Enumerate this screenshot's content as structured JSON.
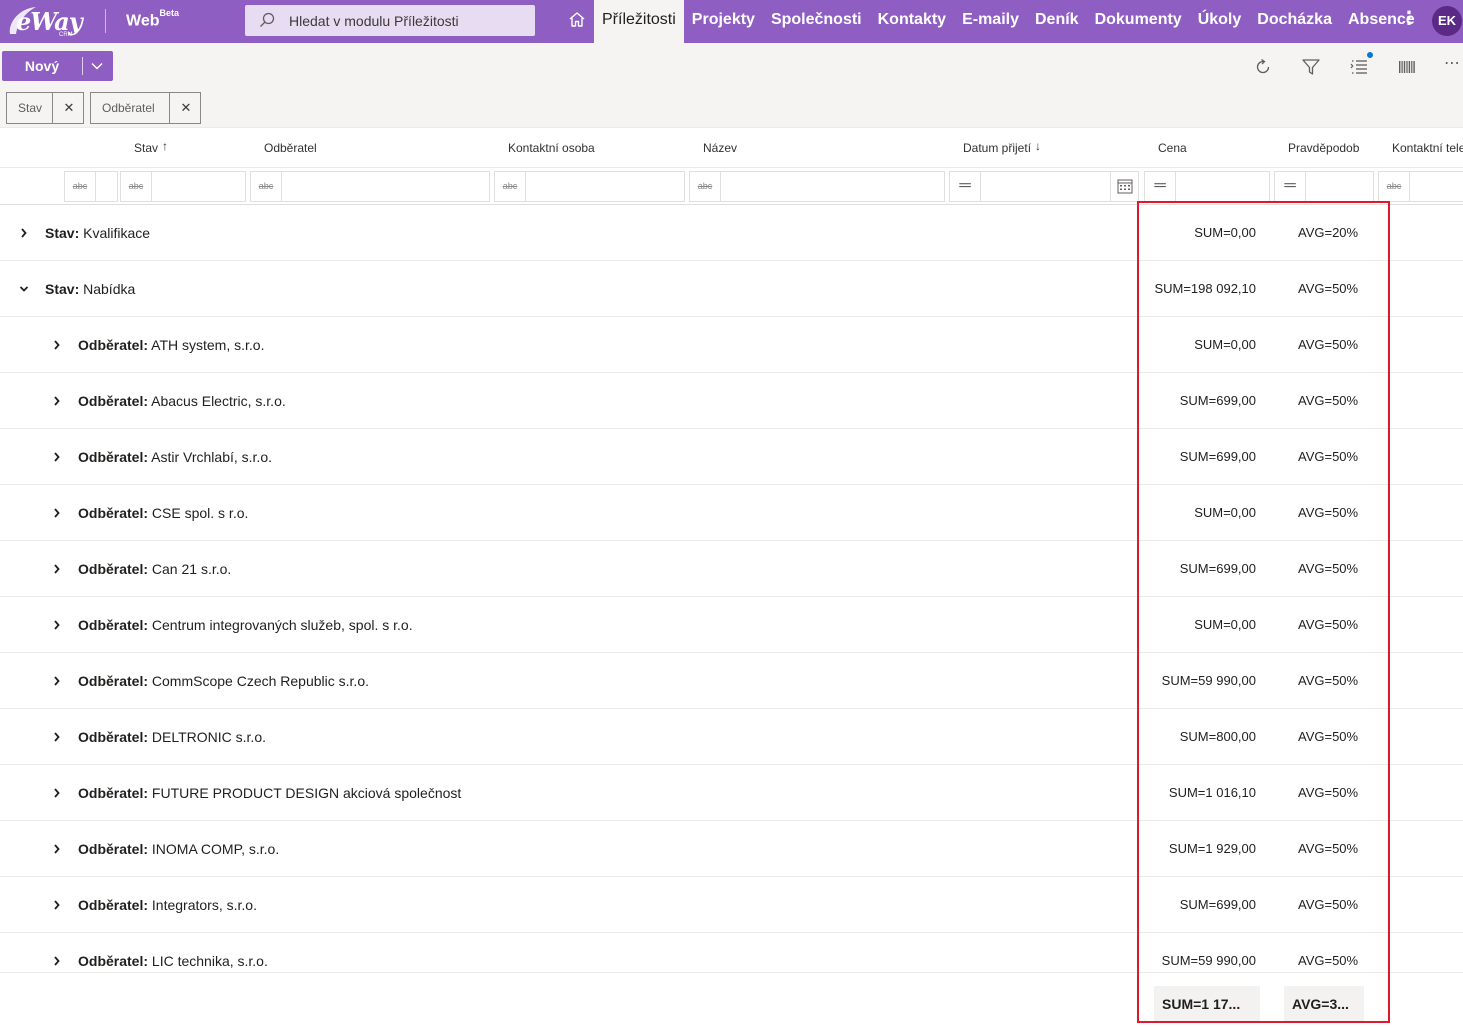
{
  "app": {
    "logo": "eWay",
    "logo_sub": "CRM",
    "web_title": "Web",
    "web_badge": "Beta",
    "search_placeholder": "Hledat v modulu Příležitosti",
    "user_initials": "EK",
    "accent_color": "#8f5ec2"
  },
  "nav": [
    {
      "label": "Příležitosti",
      "active": true
    },
    {
      "label": "Projekty"
    },
    {
      "label": "Společnosti"
    },
    {
      "label": "Kontakty"
    },
    {
      "label": "E-maily"
    },
    {
      "label": "Deník"
    },
    {
      "label": "Dokumenty"
    },
    {
      "label": "Úkoly"
    },
    {
      "label": "Docházka"
    },
    {
      "label": "Absence"
    }
  ],
  "toolbar": {
    "new_label": "Nový",
    "icons": [
      "refresh-icon",
      "filter-icon",
      "column-list-icon",
      "barcode-icon",
      "more-icon"
    ]
  },
  "group_chips": [
    {
      "label": "Stav"
    },
    {
      "label": "Odběratel"
    }
  ],
  "columns": [
    {
      "label": "Stav",
      "sort": "asc"
    },
    {
      "label": "Odběratel"
    },
    {
      "label": "Kontaktní osoba"
    },
    {
      "label": "Název"
    },
    {
      "label": "Datum přijetí",
      "sort": "desc"
    },
    {
      "label": "Cena"
    },
    {
      "label": "Pravděpodob"
    },
    {
      "label": "Kontaktní tele"
    }
  ],
  "rows": [
    {
      "level": 0,
      "expanded": false,
      "key": "Stav:",
      "value": "Kvalifikace",
      "sum": "SUM=0,00",
      "avg": "AVG=20%"
    },
    {
      "level": 0,
      "expanded": true,
      "key": "Stav:",
      "value": "Nabídka",
      "sum": "SUM=198 092,10",
      "avg": "AVG=50%"
    },
    {
      "level": 1,
      "expanded": false,
      "key": "Odběratel:",
      "value": "ATH system, s.r.o.",
      "sum": "SUM=0,00",
      "avg": "AVG=50%"
    },
    {
      "level": 1,
      "expanded": false,
      "key": "Odběratel:",
      "value": "Abacus Electric, s.r.o.",
      "sum": "SUM=699,00",
      "avg": "AVG=50%"
    },
    {
      "level": 1,
      "expanded": false,
      "key": "Odběratel:",
      "value": "Astir Vrchlabí, s.r.o.",
      "sum": "SUM=699,00",
      "avg": "AVG=50%"
    },
    {
      "level": 1,
      "expanded": false,
      "key": "Odběratel:",
      "value": "CSE spol. s r.o.",
      "sum": "SUM=0,00",
      "avg": "AVG=50%"
    },
    {
      "level": 1,
      "expanded": false,
      "key": "Odběratel:",
      "value": "Can 21 s.r.o.",
      "sum": "SUM=699,00",
      "avg": "AVG=50%"
    },
    {
      "level": 1,
      "expanded": false,
      "key": "Odběratel:",
      "value": "Centrum integrovaných služeb, spol. s r.o.",
      "sum": "SUM=0,00",
      "avg": "AVG=50%"
    },
    {
      "level": 1,
      "expanded": false,
      "key": "Odběratel:",
      "value": "CommScope Czech Republic s.r.o.",
      "sum": "SUM=59 990,00",
      "avg": "AVG=50%"
    },
    {
      "level": 1,
      "expanded": false,
      "key": "Odběratel:",
      "value": "DELTRONIC s.r.o.",
      "sum": "SUM=800,00",
      "avg": "AVG=50%"
    },
    {
      "level": 1,
      "expanded": false,
      "key": "Odběratel:",
      "value": "FUTURE PRODUCT DESIGN akciová společnost",
      "sum": "SUM=1 016,10",
      "avg": "AVG=50%"
    },
    {
      "level": 1,
      "expanded": false,
      "key": "Odběratel:",
      "value": "INOMA COMP, s.r.o.",
      "sum": "SUM=1 929,00",
      "avg": "AVG=50%"
    },
    {
      "level": 1,
      "expanded": false,
      "key": "Odběratel:",
      "value": "Integrators, s.r.o.",
      "sum": "SUM=699,00",
      "avg": "AVG=50%"
    },
    {
      "level": 1,
      "expanded": false,
      "key": "Odběratel:",
      "value": "LIC technika, s.r.o.",
      "sum": "SUM=59 990,00",
      "avg": "AVG=50%"
    }
  ],
  "totals": {
    "sum": "SUM=1 17...",
    "avg": "AVG=3..."
  },
  "highlight_color": "#e0182d"
}
